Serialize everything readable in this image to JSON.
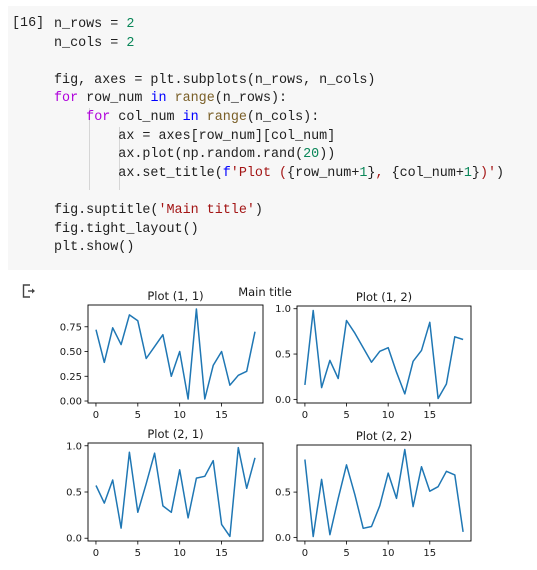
{
  "cell": {
    "execution_count": "[16]",
    "code_lines": [
      [
        {
          "t": "n_rows = "
        },
        {
          "t": "2",
          "c": "num"
        }
      ],
      [
        {
          "t": "n_cols = "
        },
        {
          "t": "2",
          "c": "num"
        }
      ],
      [],
      [
        {
          "t": "fig, axes = plt.subplots(n_rows, n_cols)"
        }
      ],
      [
        {
          "t": "for",
          "c": "kw"
        },
        {
          "t": " row_num "
        },
        {
          "t": "in",
          "c": "op"
        },
        {
          "t": " "
        },
        {
          "t": "range",
          "c": "bi"
        },
        {
          "t": "(n_rows):"
        }
      ],
      [
        {
          "t": "    "
        },
        {
          "t": "for",
          "c": "kw"
        },
        {
          "t": " col_num "
        },
        {
          "t": "in",
          "c": "op"
        },
        {
          "t": " "
        },
        {
          "t": "range",
          "c": "bi"
        },
        {
          "t": "(n_cols):"
        }
      ],
      [
        {
          "t": "        ax = axes[row_num][col_num]"
        }
      ],
      [
        {
          "t": "        ax.plot(np.random.rand("
        },
        {
          "t": "20",
          "c": "num"
        },
        {
          "t": "))"
        }
      ],
      [
        {
          "t": "        ax.set_title("
        },
        {
          "t": "f",
          "c": "fpre"
        },
        {
          "t": "'Plot (",
          "c": "str"
        },
        {
          "t": "{row_num+"
        },
        {
          "t": "1",
          "c": "num"
        },
        {
          "t": "}"
        },
        {
          "t": ", ",
          "c": "str"
        },
        {
          "t": "{col_num+"
        },
        {
          "t": "1",
          "c": "num"
        },
        {
          "t": "}"
        },
        {
          "t": ")'",
          "c": "str"
        },
        {
          "t": ")"
        }
      ],
      [],
      [
        {
          "t": "fig.suptitle("
        },
        {
          "t": "'Main title'",
          "c": "str"
        },
        {
          "t": ")"
        }
      ],
      [
        {
          "t": "fig.tight_layout()"
        }
      ],
      [
        {
          "t": "plt.show()"
        }
      ]
    ]
  },
  "output": {
    "icon": "output-redirect-icon"
  },
  "colors": {
    "line": "#1f77b4",
    "axes": "#000000",
    "cell_bg": "#f7f7f7"
  },
  "chart_data": [
    {
      "type": "line",
      "suptitle": "Main title",
      "title": "Plot (1, 1)",
      "x": [
        0,
        1,
        2,
        3,
        4,
        5,
        6,
        7,
        8,
        9,
        10,
        11,
        12,
        13,
        14,
        15,
        16,
        17,
        18,
        19
      ],
      "values": [
        0.72,
        0.39,
        0.74,
        0.57,
        0.87,
        0.81,
        0.43,
        0.55,
        0.67,
        0.25,
        0.5,
        0.02,
        0.93,
        0.02,
        0.36,
        0.5,
        0.16,
        0.26,
        0.3,
        0.7
      ],
      "xticks": [
        0,
        5,
        10,
        15
      ],
      "yticks": [
        0.0,
        0.25,
        0.5,
        0.75
      ],
      "ytick_labels": [
        "0.00",
        "0.25",
        "0.50",
        "0.75"
      ],
      "xlim": [
        -0.95,
        19.95
      ],
      "ylim": [
        -0.02,
        0.97
      ],
      "grid": false
    },
    {
      "type": "line",
      "title": "Plot (1, 2)",
      "x": [
        0,
        1,
        2,
        3,
        4,
        5,
        6,
        7,
        8,
        9,
        10,
        11,
        12,
        13,
        14,
        15,
        16,
        17,
        18,
        19
      ],
      "values": [
        0.16,
        0.98,
        0.13,
        0.43,
        0.23,
        0.87,
        0.73,
        0.57,
        0.41,
        0.53,
        0.57,
        0.3,
        0.06,
        0.42,
        0.54,
        0.85,
        0.01,
        0.17,
        0.69,
        0.66
      ],
      "xticks": [
        0,
        5,
        10,
        15
      ],
      "yticks": [
        0.0,
        0.5,
        1.0
      ],
      "ytick_labels": [
        "0.0",
        "0.5",
        "1.0"
      ],
      "xlim": [
        -0.95,
        19.95
      ],
      "ylim": [
        -0.04,
        1.03
      ],
      "grid": false
    },
    {
      "type": "line",
      "title": "Plot (2, 1)",
      "x": [
        0,
        1,
        2,
        3,
        4,
        5,
        6,
        7,
        8,
        9,
        10,
        11,
        12,
        13,
        14,
        15,
        16,
        17,
        18,
        19
      ],
      "values": [
        0.57,
        0.38,
        0.63,
        0.11,
        0.93,
        0.28,
        0.59,
        0.92,
        0.35,
        0.28,
        0.74,
        0.22,
        0.65,
        0.67,
        0.84,
        0.15,
        0.02,
        0.98,
        0.54,
        0.87
      ],
      "xticks": [
        0,
        5,
        10,
        15
      ],
      "yticks": [
        0.0,
        0.5,
        1.0
      ],
      "ytick_labels": [
        "0.0",
        "0.5",
        "1.0"
      ],
      "xlim": [
        -0.95,
        19.95
      ],
      "ylim": [
        -0.03,
        1.03
      ],
      "grid": false
    },
    {
      "type": "line",
      "title": "Plot (2, 2)",
      "x": [
        0,
        1,
        2,
        3,
        4,
        5,
        6,
        7,
        8,
        9,
        10,
        11,
        12,
        13,
        14,
        15,
        16,
        17,
        18,
        19
      ],
      "values": [
        0.86,
        0.01,
        0.64,
        0.03,
        0.43,
        0.8,
        0.47,
        0.1,
        0.12,
        0.35,
        0.71,
        0.43,
        0.97,
        0.34,
        0.78,
        0.51,
        0.56,
        0.73,
        0.69,
        0.06
      ],
      "xticks": [
        0,
        5,
        10,
        15
      ],
      "yticks": [
        0.0,
        0.5
      ],
      "ytick_labels": [
        "0.0",
        "0.5"
      ],
      "xlim": [
        -0.95,
        19.95
      ],
      "ylim": [
        -0.04,
        1.02
      ],
      "grid": false
    }
  ]
}
